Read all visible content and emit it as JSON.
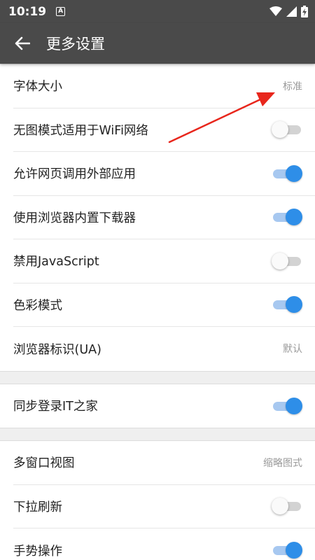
{
  "status_bar": {
    "time": "10:19",
    "app_icon_letter": "A"
  },
  "app_bar": {
    "title": "更多设置"
  },
  "groups": [
    [
      {
        "label": "字体大小",
        "type": "value",
        "value": "标准"
      },
      {
        "label": "无图模式适用于WiFi网络",
        "type": "toggle",
        "on": false
      },
      {
        "label": "允许网页调用外部应用",
        "type": "toggle",
        "on": true
      },
      {
        "label": "使用浏览器内置下载器",
        "type": "toggle",
        "on": true
      },
      {
        "label": "禁用JavaScript",
        "type": "toggle",
        "on": false
      },
      {
        "label": "色彩模式",
        "type": "toggle",
        "on": true
      },
      {
        "label": "浏览器标识(UA)",
        "type": "value",
        "value": "默认"
      }
    ],
    [
      {
        "label": "同步登录IT之家",
        "type": "toggle",
        "on": true
      }
    ],
    [
      {
        "label": "多窗口视图",
        "type": "value",
        "value": "缩略图式"
      },
      {
        "label": "下拉刷新",
        "type": "toggle",
        "on": false
      },
      {
        "label": "手势操作",
        "type": "toggle",
        "on": true
      }
    ]
  ],
  "colors": {
    "toolbar": "#4a4a4a",
    "toggle_on": "#2e8ee8",
    "arrow": "#e8261c"
  }
}
